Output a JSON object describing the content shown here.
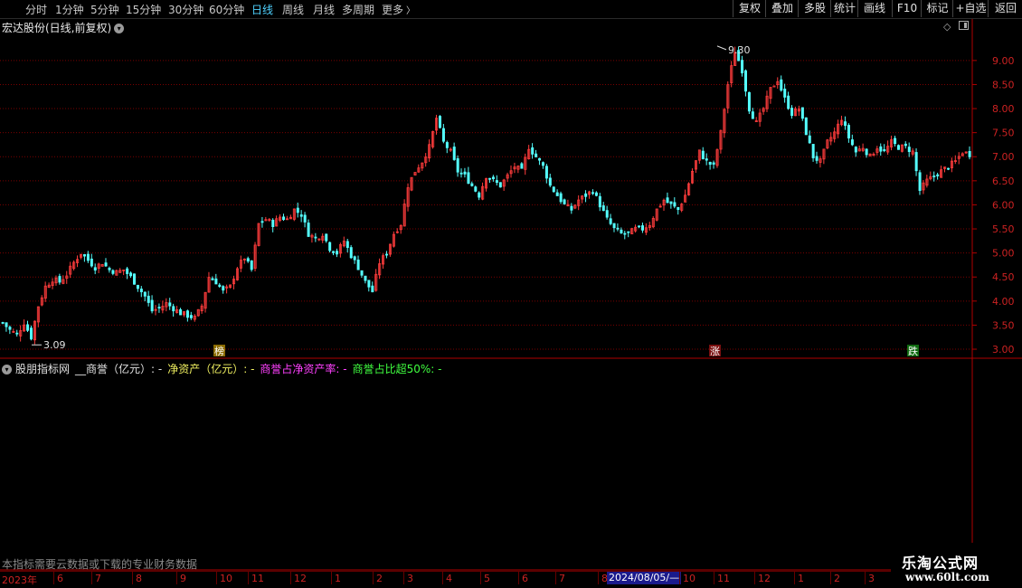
{
  "toolbar": {
    "timeframes": [
      {
        "label": "分时",
        "active": false
      },
      {
        "label": "1分钟",
        "active": false
      },
      {
        "label": "5分钟",
        "active": false
      },
      {
        "label": "15分钟",
        "active": false
      },
      {
        "label": "30分钟",
        "active": false
      },
      {
        "label": "60分钟",
        "active": false
      },
      {
        "label": "日线",
        "active": true
      },
      {
        "label": "周线",
        "active": false
      },
      {
        "label": "月线",
        "active": false
      },
      {
        "label": "多周期",
        "active": false
      },
      {
        "label": "更多",
        "active": false
      }
    ],
    "more_arrow": "〉",
    "right_buttons": [
      "复权",
      "叠加",
      "多股",
      "统计",
      "画线",
      "F10",
      "标记",
      "+自选",
      "返回"
    ]
  },
  "chart": {
    "title": "宏达股份(日线,前复权)",
    "title_toggle_icon": "chevron-down-icon",
    "price_axis": [
      "9.00",
      "8.50",
      "8.00",
      "7.50",
      "7.00",
      "6.50",
      "6.00",
      "5.50",
      "5.00",
      "4.50",
      "4.00",
      "3.50",
      "3.00"
    ],
    "high_label": "9.30",
    "low_label": "3.09",
    "markers": [
      {
        "text": "榜",
        "bg": "#8a6a00",
        "color": "#ffffff"
      },
      {
        "text": "涨",
        "bg": "#7a1010",
        "color": "#ffffff"
      },
      {
        "text": "跌",
        "bg": "#0f6a10",
        "color": "#ffffff"
      }
    ]
  },
  "indicator": {
    "name": "股朋指标网",
    "items": [
      {
        "text": "__商誉（亿元）: -",
        "color": "#e0e0e0"
      },
      {
        "text": "净资产（亿元）: -",
        "color": "#f0f060"
      },
      {
        "text": "商誉占净资产率: -",
        "color": "#ff40ff"
      },
      {
        "text": "商誉占比超50%: -",
        "color": "#40ff40"
      }
    ]
  },
  "footer_note": "本指标需要云数据或下载的专业财务数据",
  "date_axis": {
    "year_label": "2023年",
    "months": [
      "6",
      "7",
      "8",
      "9",
      "10",
      "11",
      "12",
      "1",
      "2",
      "3",
      "4",
      "5",
      "6",
      "7",
      "8",
      "10",
      "11",
      "12",
      "1",
      "2",
      "3"
    ],
    "highlight": "2024/08/05/—"
  },
  "watermark": {
    "title": "乐淘公式网",
    "url": "www.60lt.com"
  },
  "colors": {
    "up": "#ff3c3c",
    "down": "#54ffff",
    "grid": "#7a0000",
    "axis": "#b00000"
  },
  "chart_data": {
    "type": "candlestick",
    "y_axis_ticks": [
      3.0,
      3.5,
      4.0,
      4.5,
      5.0,
      5.5,
      6.0,
      6.5,
      7.0,
      7.5,
      8.0,
      8.5,
      9.0
    ],
    "ylim": [
      2.9,
      9.6
    ],
    "high": 9.3,
    "low": 3.09,
    "close_path": [
      3.55,
      3.4,
      3.3,
      3.55,
      3.25,
      3.9,
      4.3,
      4.45,
      4.4,
      4.55,
      4.8,
      5.0,
      4.85,
      4.7,
      4.8,
      4.65,
      4.6,
      4.65,
      4.5,
      4.3,
      4.1,
      3.8,
      3.85,
      3.95,
      3.85,
      3.75,
      3.7,
      3.65,
      3.9,
      4.5,
      4.4,
      4.2,
      4.3,
      4.7,
      4.9,
      4.65,
      5.6,
      5.7,
      5.6,
      5.75,
      5.7,
      5.9,
      5.8,
      5.4,
      5.3,
      5.4,
      5.1,
      5.0,
      5.25,
      4.95,
      4.7,
      4.4,
      4.2,
      4.8,
      5.0,
      5.4,
      5.6,
      6.4,
      6.7,
      6.9,
      7.2,
      7.8,
      7.3,
      7.1,
      6.7,
      6.6,
      6.4,
      6.2,
      6.6,
      6.5,
      6.4,
      6.6,
      6.8,
      6.7,
      7.2,
      7.0,
      6.8,
      6.4,
      6.2,
      6.0,
      5.9,
      6.1,
      6.2,
      6.3,
      6.0,
      5.7,
      5.5,
      5.4,
      5.4,
      5.5,
      5.5,
      5.6,
      5.9,
      6.1,
      6.0,
      5.9,
      6.2,
      6.7,
      7.1,
      6.9,
      6.8,
      7.5,
      8.5,
      9.2,
      8.8,
      8.0,
      7.7,
      8.0,
      8.4,
      8.6,
      8.2,
      7.9,
      8.0,
      7.5,
      7.0,
      6.9,
      7.3,
      7.5,
      7.8,
      7.4,
      7.1,
      7.2,
      7.0,
      7.2,
      7.1,
      7.3,
      7.2,
      7.2,
      7.1,
      6.3,
      6.5,
      6.6,
      6.7,
      6.8,
      6.9,
      7.1,
      7.05
    ]
  }
}
